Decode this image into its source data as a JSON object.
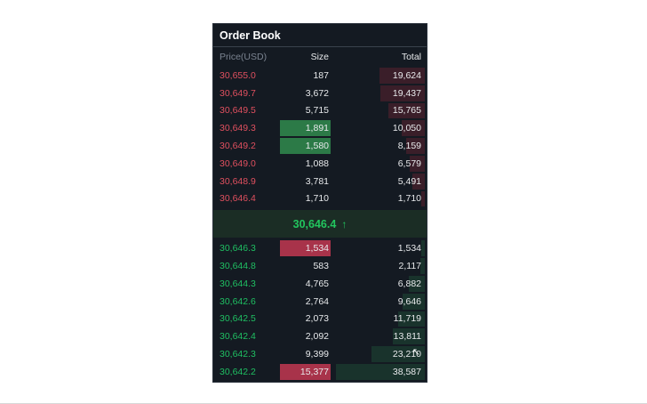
{
  "order_book": {
    "title": "Order Book",
    "columns": {
      "price": "Price(USD)",
      "size": "Size",
      "total": "Total"
    },
    "colors": {
      "ask": "#e0505f",
      "bid": "#1fbf62",
      "highlight_green": "#2c7a47",
      "highlight_red": "#a8334a"
    },
    "asks": [
      {
        "price": "30,655.0",
        "size": "187",
        "total": "19,624",
        "depth_fraction": 0.51
      },
      {
        "price": "30,649.7",
        "size": "3,672",
        "total": "19,437",
        "depth_fraction": 0.5
      },
      {
        "price": "30,649.5",
        "size": "5,715",
        "total": "15,765",
        "depth_fraction": 0.41
      },
      {
        "price": "30,649.3",
        "size": "1,891",
        "total": "10,050",
        "depth_fraction": 0.26
      },
      {
        "price": "30,649.2",
        "size": "1,580",
        "total": "8,159",
        "depth_fraction": 0.21
      },
      {
        "price": "30,649.0",
        "size": "1,088",
        "total": "6,579",
        "depth_fraction": 0.17
      },
      {
        "price": "30,648.9",
        "size": "3,781",
        "total": "5,491",
        "depth_fraction": 0.14
      },
      {
        "price": "30,646.4",
        "size": "1,710",
        "total": "1,710",
        "depth_fraction": 0.04
      }
    ],
    "mid_price": {
      "value": "30,646.4",
      "direction_icon": "arrow-up-icon"
    },
    "bids": [
      {
        "price": "30,646.3",
        "size": "1,534",
        "total": "1,534",
        "depth_fraction": 0.04
      },
      {
        "price": "30,644.8",
        "size": "583",
        "total": "2,117",
        "depth_fraction": 0.05
      },
      {
        "price": "30,644.3",
        "size": "4,765",
        "total": "6,882",
        "depth_fraction": 0.18
      },
      {
        "price": "30,642.6",
        "size": "2,764",
        "total": "9,646",
        "depth_fraction": 0.25
      },
      {
        "price": "30,642.5",
        "size": "2,073",
        "total": "11,719",
        "depth_fraction": 0.3
      },
      {
        "price": "30,642.4",
        "size": "2,092",
        "total": "13,811",
        "depth_fraction": 0.36
      },
      {
        "price": "30,642.3",
        "size": "9,399",
        "total": "23,210",
        "depth_fraction": 0.6
      },
      {
        "price": "30,642.2",
        "size": "15,377",
        "total": "38,587",
        "depth_fraction": 1.0
      }
    ]
  }
}
